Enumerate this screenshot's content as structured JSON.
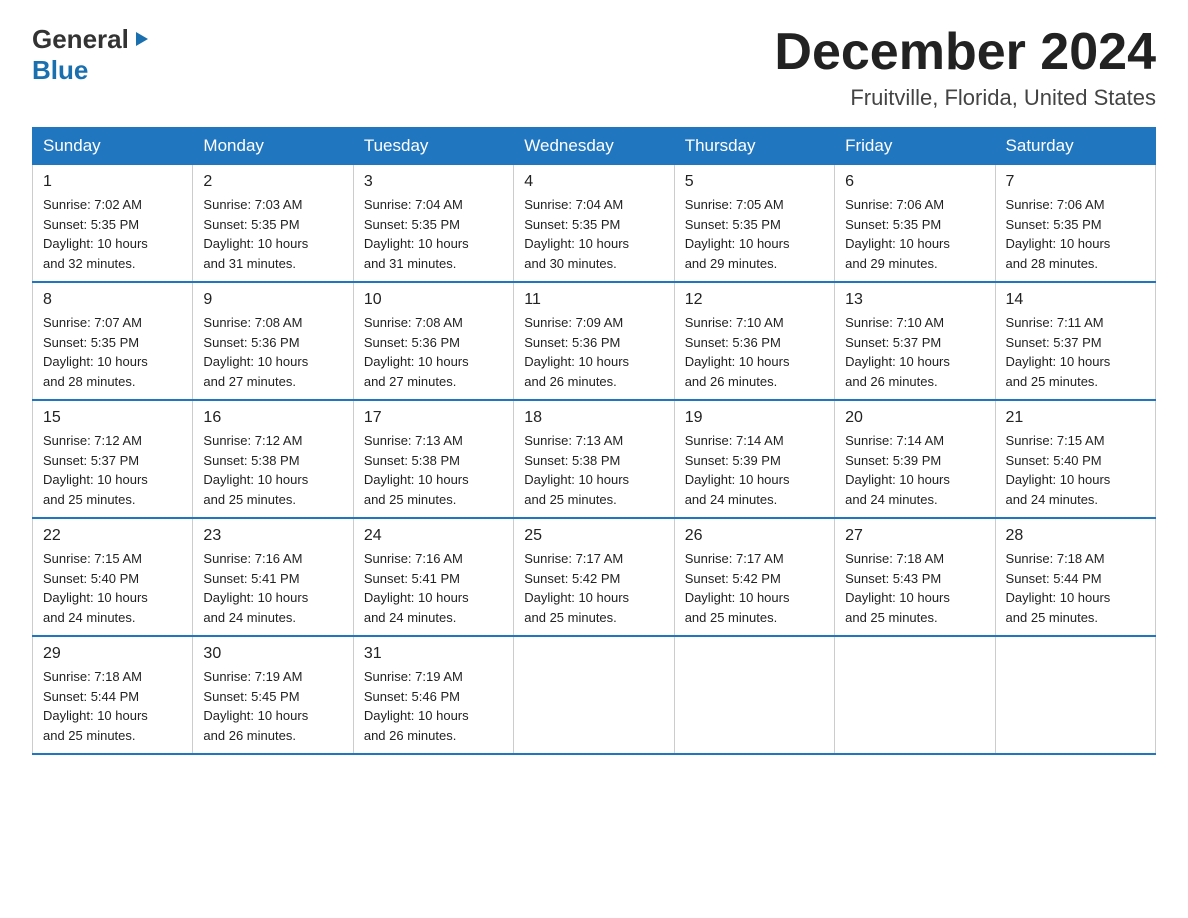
{
  "header": {
    "logo_line1": "General",
    "logo_triangle": "▶",
    "logo_line2": "Blue",
    "calendar_title": "December 2024",
    "calendar_subtitle": "Fruitville, Florida, United States"
  },
  "weekdays": [
    "Sunday",
    "Monday",
    "Tuesday",
    "Wednesday",
    "Thursday",
    "Friday",
    "Saturday"
  ],
  "weeks": [
    [
      {
        "day": "1",
        "sunrise": "7:02 AM",
        "sunset": "5:35 PM",
        "daylight": "10 hours and 32 minutes."
      },
      {
        "day": "2",
        "sunrise": "7:03 AM",
        "sunset": "5:35 PM",
        "daylight": "10 hours and 31 minutes."
      },
      {
        "day": "3",
        "sunrise": "7:04 AM",
        "sunset": "5:35 PM",
        "daylight": "10 hours and 31 minutes."
      },
      {
        "day": "4",
        "sunrise": "7:04 AM",
        "sunset": "5:35 PM",
        "daylight": "10 hours and 30 minutes."
      },
      {
        "day": "5",
        "sunrise": "7:05 AM",
        "sunset": "5:35 PM",
        "daylight": "10 hours and 29 minutes."
      },
      {
        "day": "6",
        "sunrise": "7:06 AM",
        "sunset": "5:35 PM",
        "daylight": "10 hours and 29 minutes."
      },
      {
        "day": "7",
        "sunrise": "7:06 AM",
        "sunset": "5:35 PM",
        "daylight": "10 hours and 28 minutes."
      }
    ],
    [
      {
        "day": "8",
        "sunrise": "7:07 AM",
        "sunset": "5:35 PM",
        "daylight": "10 hours and 28 minutes."
      },
      {
        "day": "9",
        "sunrise": "7:08 AM",
        "sunset": "5:36 PM",
        "daylight": "10 hours and 27 minutes."
      },
      {
        "day": "10",
        "sunrise": "7:08 AM",
        "sunset": "5:36 PM",
        "daylight": "10 hours and 27 minutes."
      },
      {
        "day": "11",
        "sunrise": "7:09 AM",
        "sunset": "5:36 PM",
        "daylight": "10 hours and 26 minutes."
      },
      {
        "day": "12",
        "sunrise": "7:10 AM",
        "sunset": "5:36 PM",
        "daylight": "10 hours and 26 minutes."
      },
      {
        "day": "13",
        "sunrise": "7:10 AM",
        "sunset": "5:37 PM",
        "daylight": "10 hours and 26 minutes."
      },
      {
        "day": "14",
        "sunrise": "7:11 AM",
        "sunset": "5:37 PM",
        "daylight": "10 hours and 25 minutes."
      }
    ],
    [
      {
        "day": "15",
        "sunrise": "7:12 AM",
        "sunset": "5:37 PM",
        "daylight": "10 hours and 25 minutes."
      },
      {
        "day": "16",
        "sunrise": "7:12 AM",
        "sunset": "5:38 PM",
        "daylight": "10 hours and 25 minutes."
      },
      {
        "day": "17",
        "sunrise": "7:13 AM",
        "sunset": "5:38 PM",
        "daylight": "10 hours and 25 minutes."
      },
      {
        "day": "18",
        "sunrise": "7:13 AM",
        "sunset": "5:38 PM",
        "daylight": "10 hours and 25 minutes."
      },
      {
        "day": "19",
        "sunrise": "7:14 AM",
        "sunset": "5:39 PM",
        "daylight": "10 hours and 24 minutes."
      },
      {
        "day": "20",
        "sunrise": "7:14 AM",
        "sunset": "5:39 PM",
        "daylight": "10 hours and 24 minutes."
      },
      {
        "day": "21",
        "sunrise": "7:15 AM",
        "sunset": "5:40 PM",
        "daylight": "10 hours and 24 minutes."
      }
    ],
    [
      {
        "day": "22",
        "sunrise": "7:15 AM",
        "sunset": "5:40 PM",
        "daylight": "10 hours and 24 minutes."
      },
      {
        "day": "23",
        "sunrise": "7:16 AM",
        "sunset": "5:41 PM",
        "daylight": "10 hours and 24 minutes."
      },
      {
        "day": "24",
        "sunrise": "7:16 AM",
        "sunset": "5:41 PM",
        "daylight": "10 hours and 24 minutes."
      },
      {
        "day": "25",
        "sunrise": "7:17 AM",
        "sunset": "5:42 PM",
        "daylight": "10 hours and 25 minutes."
      },
      {
        "day": "26",
        "sunrise": "7:17 AM",
        "sunset": "5:42 PM",
        "daylight": "10 hours and 25 minutes."
      },
      {
        "day": "27",
        "sunrise": "7:18 AM",
        "sunset": "5:43 PM",
        "daylight": "10 hours and 25 minutes."
      },
      {
        "day": "28",
        "sunrise": "7:18 AM",
        "sunset": "5:44 PM",
        "daylight": "10 hours and 25 minutes."
      }
    ],
    [
      {
        "day": "29",
        "sunrise": "7:18 AM",
        "sunset": "5:44 PM",
        "daylight": "10 hours and 25 minutes."
      },
      {
        "day": "30",
        "sunrise": "7:19 AM",
        "sunset": "5:45 PM",
        "daylight": "10 hours and 26 minutes."
      },
      {
        "day": "31",
        "sunrise": "7:19 AM",
        "sunset": "5:46 PM",
        "daylight": "10 hours and 26 minutes."
      },
      null,
      null,
      null,
      null
    ]
  ],
  "labels": {
    "sunrise": "Sunrise:",
    "sunset": "Sunset:",
    "daylight": "Daylight:"
  }
}
